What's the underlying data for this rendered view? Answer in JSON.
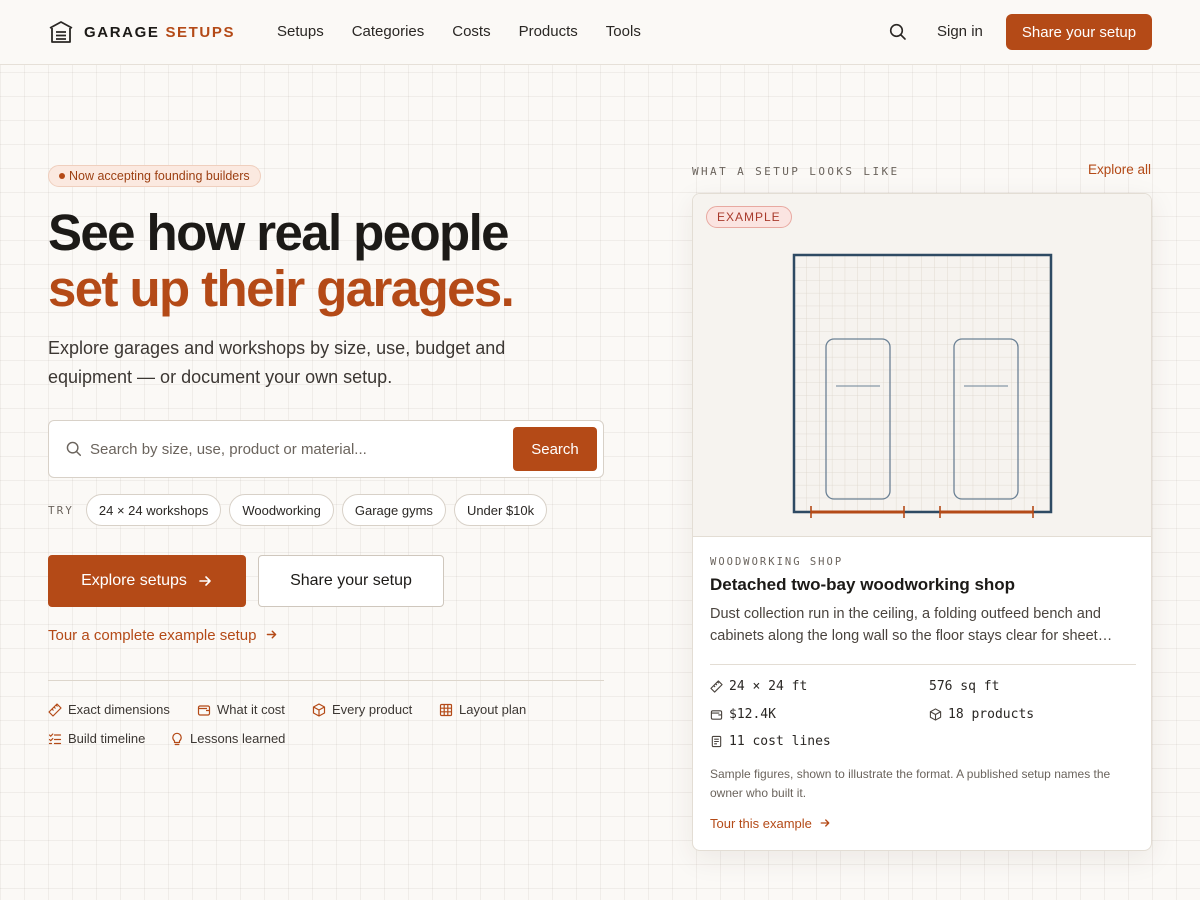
{
  "brand": {
    "word1": "GARAGE",
    "word2": "SETUPS",
    "accent": "#b44a17"
  },
  "nav": {
    "items": [
      "Setups",
      "Categories",
      "Costs",
      "Products",
      "Tools"
    ],
    "search_icon": "search-icon",
    "signin": "Sign in",
    "share": "Share your setup"
  },
  "hero": {
    "badge": "Now accepting founding builders",
    "title_line1": "See how real people",
    "title_line2": "set up their garages.",
    "lead": "Explore garages and workshops by size, use, budget and equipment — or document your own setup.",
    "search": {
      "placeholder": "Search by size, use, product or material...",
      "value": "",
      "button": "Search"
    },
    "try_label": "TRY",
    "chips": [
      "24 × 24 workshops",
      "Woodworking",
      "Garage gyms",
      "Under $10k"
    ],
    "explore_button": "Explore setups",
    "share_button": "Share your setup",
    "tour_link": "Tour a complete example setup",
    "features": [
      {
        "label": "Exact dimensions",
        "icon": "ruler-icon"
      },
      {
        "label": "What it cost",
        "icon": "wallet-icon"
      },
      {
        "label": "Every product",
        "icon": "box-icon"
      },
      {
        "label": "Layout plan",
        "icon": "grid-icon"
      },
      {
        "label": "Build timeline",
        "icon": "checklist-icon"
      },
      {
        "label": "Lessons learned",
        "icon": "lightbulb-icon"
      }
    ]
  },
  "example": {
    "section_label": "WHAT A SETUP LOOKS LIKE",
    "explore_all": "Explore all",
    "badge": "EXAMPLE",
    "kind": "WOODWORKING SHOP",
    "title": "Detached two-bay woodworking shop",
    "description": "Dust collection run in the ceiling, a folding outfeed bench and cabinets along the long wall so the floor stays clear for sheet goods.",
    "stats": {
      "dimensions": "24 × 24 ft",
      "area": "576 sq ft",
      "cost": "$12.4K",
      "products": "18 products",
      "cost_lines": "11 cost lines"
    },
    "note": "Sample figures, shown to illustrate the format. A published setup names the owner who built it.",
    "tour_link": "Tour this example"
  }
}
